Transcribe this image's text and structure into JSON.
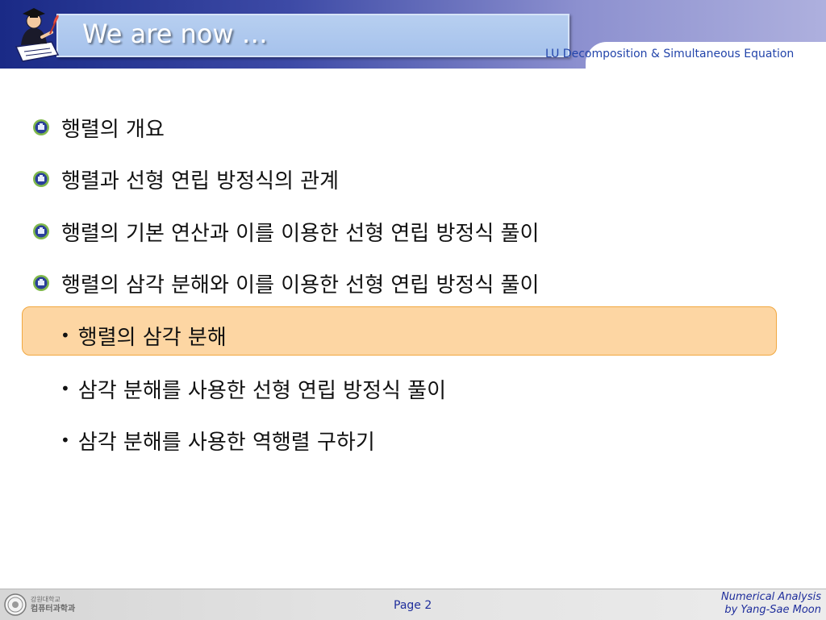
{
  "header": {
    "title": "We are now …",
    "subtitle": "LU Decomposition & Simultaneous Equation"
  },
  "content": {
    "items": [
      "행렬의 개요",
      "행렬과 선형 연립 방정식의 관계",
      "행렬의 기본 연산과 이를 이용한 선형 연립 방정식 풀이",
      "행렬의 삼각 분해와 이를 이용한 선형 연립 방정식 풀이"
    ],
    "sub_items": [
      "행렬의 삼각 분해",
      "삼각 분해를 사용한 선형 연립 방정식 풀이",
      "삼각 분해를 사용한 역행렬 구하기"
    ],
    "highlighted_sub_item": 0,
    "bullet_char": "•"
  },
  "footer": {
    "logo_line1": "강원대학교",
    "logo_line2": "컴퓨터과학과",
    "page": "Page 2",
    "credit_line1": "Numerical Analysis",
    "credit_line2": "by Yang-Sae Moon"
  },
  "colors": {
    "header_dark": "#1a2a86",
    "title_box": "#a6c2ec",
    "highlight_fill": "#fdd6a3",
    "highlight_border": "#f1a840",
    "footer_text": "#1f2e9c"
  }
}
